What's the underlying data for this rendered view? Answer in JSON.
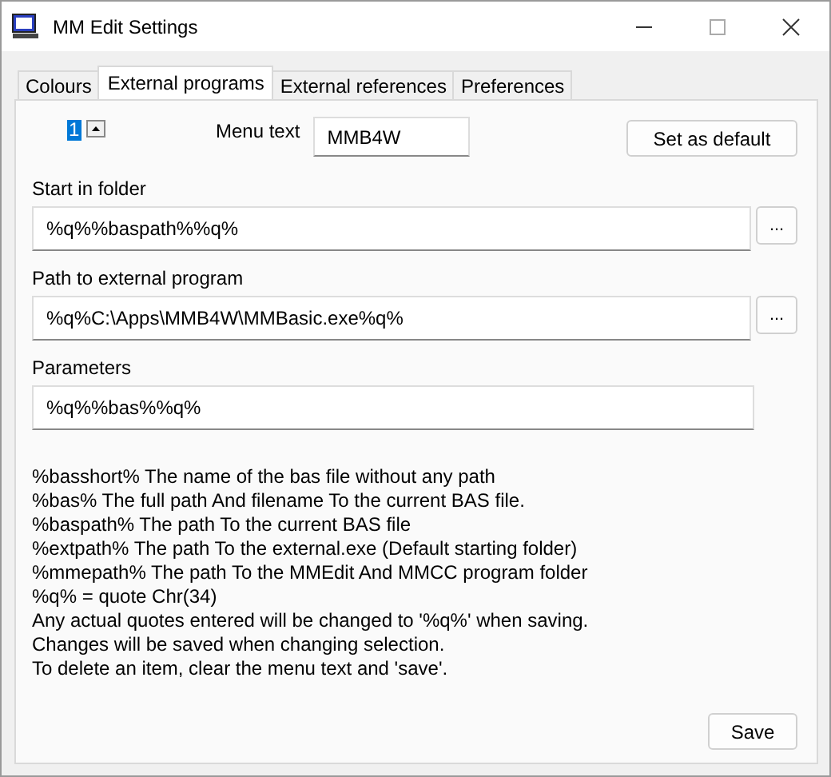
{
  "window": {
    "title": "MM Edit Settings"
  },
  "tabs": [
    {
      "label": "Colours",
      "selected": false
    },
    {
      "label": "External programs",
      "selected": true
    },
    {
      "label": "External references",
      "selected": false
    },
    {
      "label": "Preferences",
      "selected": false
    }
  ],
  "item_number": {
    "value": "1"
  },
  "menu_text": {
    "label": "Menu text",
    "value": "MMB4W"
  },
  "set_default_button": "Set as default",
  "fields": [
    {
      "label": "Start in folder",
      "value": "%q%%baspath%%q%",
      "browse": "..."
    },
    {
      "label": "Path to external program",
      "value": "%q%C:\\Apps\\MMB4W\\MMBasic.exe%q%",
      "browse": "..."
    },
    {
      "label": "Parameters",
      "value": "%q%%bas%%q%"
    }
  ],
  "help_lines": [
    "%basshort% The name of the bas file without any path",
    "%bas% The full path And filename To the current BAS file.",
    "%baspath% The path To the current BAS file",
    "%extpath% The path To the external.exe (Default starting folder)",
    "%mmepath% The path To the MMEdit And MMCC program folder",
    "%q% = quote Chr(34)",
    "Any actual quotes entered will be changed to '%q%' when saving.",
    "Changes will be saved when changing selection.",
    "To delete an item, clear the menu text and 'save'."
  ],
  "save_button": "Save"
}
